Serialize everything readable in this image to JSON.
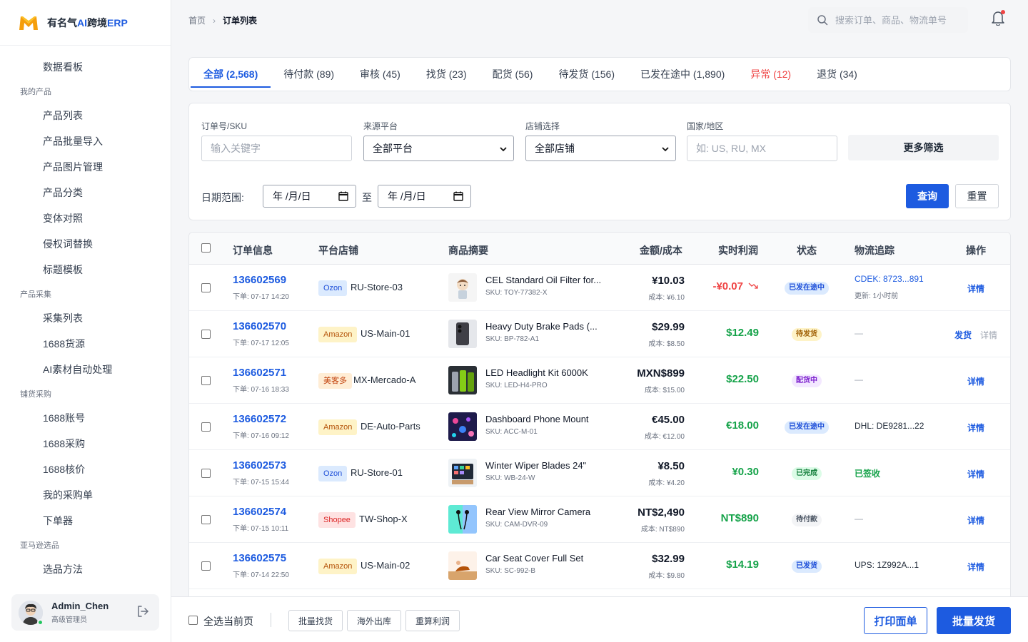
{
  "brand": {
    "name_prefix": "有名气",
    "name_ai": "AI",
    "name_mid": "跨境",
    "name_erp": "ERP",
    "accent": "#1d5be0"
  },
  "sidebar": {
    "items": [
      {
        "type": "item",
        "label": "数据看板",
        "name": "dashboard"
      },
      {
        "type": "group",
        "label": "我的产品"
      },
      {
        "type": "item",
        "label": "产品列表",
        "name": "product-list"
      },
      {
        "type": "item",
        "label": "产品批量导入",
        "name": "product-import"
      },
      {
        "type": "item",
        "label": "产品图片管理",
        "name": "product-images"
      },
      {
        "type": "item",
        "label": "产品分类",
        "name": "product-category"
      },
      {
        "type": "item",
        "label": "变体对照",
        "name": "variant-mapping"
      },
      {
        "type": "item",
        "label": "侵权词替换",
        "name": "infringing-words"
      },
      {
        "type": "item",
        "label": "标题模板",
        "name": "title-template"
      },
      {
        "type": "group",
        "label": "产品采集"
      },
      {
        "type": "item",
        "label": "采集列表",
        "name": "collect-list"
      },
      {
        "type": "item",
        "label": "1688货源",
        "name": "1688-source"
      },
      {
        "type": "item",
        "label": "AI素材自动处理",
        "name": "ai-material"
      },
      {
        "type": "group",
        "label": "铺货采购"
      },
      {
        "type": "item",
        "label": "1688账号",
        "name": "1688-account"
      },
      {
        "type": "item",
        "label": "1688采购",
        "name": "1688-purchase"
      },
      {
        "type": "item",
        "label": "1688核价",
        "name": "1688-pricing"
      },
      {
        "type": "item",
        "label": "我的采购单",
        "name": "my-purchase-orders"
      },
      {
        "type": "item",
        "label": "下单器",
        "name": "order-placer"
      },
      {
        "type": "group",
        "label": "亚马逊选品"
      },
      {
        "type": "item",
        "label": "选品方法",
        "name": "selection-method"
      }
    ]
  },
  "user": {
    "name": "Admin_Chen",
    "role": "高级管理员"
  },
  "header": {
    "breadcrumb": [
      "首页",
      "订单列表"
    ],
    "search_placeholder": "搜索订单、商品、物流单号"
  },
  "tabs": [
    {
      "label": "全部 (2,568)",
      "state": "active"
    },
    {
      "label": "待付款 (89)",
      "state": ""
    },
    {
      "label": "审核 (45)",
      "state": ""
    },
    {
      "label": "找货 (23)",
      "state": ""
    },
    {
      "label": "配货 (56)",
      "state": ""
    },
    {
      "label": "待发货 (156)",
      "state": ""
    },
    {
      "label": "已发在途中 (1,890)",
      "state": ""
    },
    {
      "label": "异常 (12)",
      "state": "warn"
    },
    {
      "label": "退货 (34)",
      "state": ""
    }
  ],
  "filters": {
    "order_label": "订单号/SKU",
    "order_placeholder": "输入关键字",
    "platform_label": "来源平台",
    "platform_value": "全部平台",
    "store_label": "店铺选择",
    "store_value": "全部店铺",
    "country_label": "国家/地区",
    "country_placeholder": "如: US, RU, MX",
    "more_label": "更多筛选",
    "date_label": "日期范围:",
    "date_placeholder": "年 /月/日",
    "date_sep": "至",
    "query_label": "查询",
    "reset_label": "重置"
  },
  "table": {
    "columns": [
      "订单信息",
      "平台店铺",
      "商品摘要",
      "金额/成本",
      "实时利润",
      "状态",
      "物流追踪",
      "操作"
    ],
    "rows": [
      {
        "order": "136602569",
        "time": "下单: 07-17 14:20",
        "platform": "Ozon",
        "store": "RU-Store-03",
        "product": "CEL Standard Oil Filter for...",
        "sku": "SKU: TOY-77382-X",
        "amount": "¥10.03",
        "cost": "成本: ¥6.10",
        "profit": "-¥0.07",
        "profit_type": "neg",
        "status": "已发在途中",
        "status_type": "blue",
        "logistics": "CDEK: 8723...891",
        "logistics_type": "link",
        "logistics_sub": "更新: 1小时前",
        "ops": [
          "详情"
        ],
        "thumb": "figure"
      },
      {
        "order": "136602570",
        "time": "下单: 07-17 12:05",
        "platform": "Amazon",
        "store": "US-Main-01",
        "product": "Heavy Duty Brake Pads (...",
        "sku": "SKU: BP-782-A1",
        "amount": "$29.99",
        "cost": "成本: $8.50",
        "profit": "$12.49",
        "profit_type": "pos",
        "status": "待发货",
        "status_type": "yellow",
        "logistics": "—",
        "logistics_type": "dash",
        "logistics_sub": "",
        "ops": [
          "发货",
          "详情"
        ],
        "thumb": "phone"
      },
      {
        "order": "136602571",
        "time": "下单: 07-16 18:33",
        "platform": "美客多",
        "store": "MX-Mercado-A",
        "product": "LED Headlight Kit 6000K",
        "sku": "SKU: LED-H4-PRO",
        "amount": "MXN$899",
        "cost": "成本: $15.00",
        "profit": "$22.50",
        "profit_type": "pos",
        "status": "配货中",
        "status_type": "purple",
        "logistics": "—",
        "logistics_type": "dash",
        "logistics_sub": "",
        "ops": [
          "详情"
        ],
        "thumb": "cans"
      },
      {
        "order": "136602572",
        "time": "下单: 07-16 09:12",
        "platform": "Amazon",
        "store": "DE-Auto-Parts",
        "product": "Dashboard Phone Mount",
        "sku": "SKU: ACC-M-01",
        "amount": "€45.00",
        "cost": "成本: €12.00",
        "profit": "€18.00",
        "profit_type": "pos",
        "status": "已发在途中",
        "status_type": "blue",
        "logistics": "DHL: DE9281...22",
        "logistics_type": "plain",
        "logistics_sub": "",
        "ops": [
          "详情"
        ],
        "thumb": "lights"
      },
      {
        "order": "136602573",
        "time": "下单: 07-15 15:44",
        "platform": "Ozon",
        "store": "RU-Store-01",
        "product": "Winter Wiper Blades 24\"",
        "sku": "SKU: WB-24-W",
        "amount": "¥8.50",
        "cost": "成本: ¥4.20",
        "profit": "¥0.30",
        "profit_type": "pos",
        "status": "已完成",
        "status_type": "green",
        "logistics": "已签收",
        "logistics_type": "done",
        "logistics_sub": "",
        "ops": [
          "详情"
        ],
        "thumb": "tablet"
      },
      {
        "order": "136602574",
        "time": "下单: 07-15 10:11",
        "platform": "Shopee",
        "store": "TW-Shop-X",
        "product": "Rear View Mirror Camera",
        "sku": "SKU: CAM-DVR-09",
        "amount": "NT$2,490",
        "cost": "成本: NT$890",
        "profit": "NT$890",
        "profit_type": "pos",
        "status": "待付款",
        "status_type": "gray",
        "logistics": "—",
        "logistics_type": "dash",
        "logistics_sub": "",
        "ops": [
          "详情"
        ],
        "thumb": "earphone"
      },
      {
        "order": "136602575",
        "time": "下单: 07-14 22:50",
        "platform": "Amazon",
        "store": "US-Main-02",
        "product": "Car Seat Cover Full Set",
        "sku": "SKU: SC-992-B",
        "amount": "$32.99",
        "cost": "成本: $9.80",
        "profit": "$14.19",
        "profit_type": "pos",
        "status": "已发货",
        "status_type": "blue",
        "logistics": "UPS: 1Z992A...1",
        "logistics_type": "plain",
        "logistics_sub": "",
        "ops": [
          "详情"
        ],
        "thumb": "yoga"
      }
    ]
  },
  "bottom": {
    "select_all": "全选当前页",
    "buttons": [
      "批量找货",
      "海外出库",
      "重算利润"
    ],
    "print_label": "打印面单",
    "ship_label": "批量发货"
  }
}
